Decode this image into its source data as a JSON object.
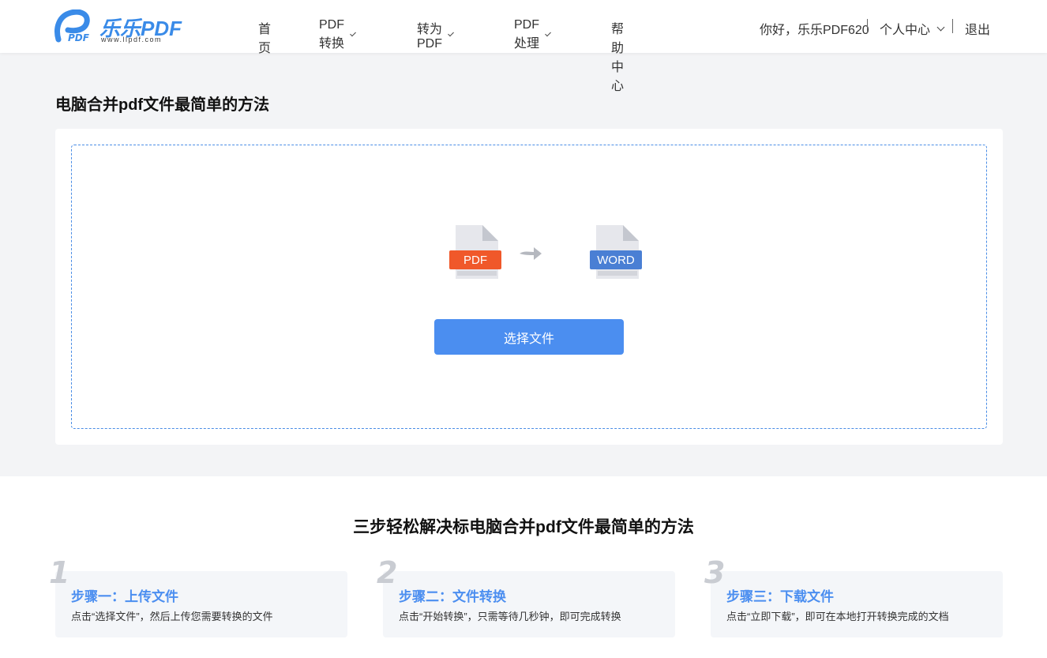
{
  "header": {
    "logo_text": "乐乐PDF",
    "logo_sub": "www.llpdf.com",
    "logo_mark_text": "PDF",
    "nav": [
      {
        "label": "首页",
        "has_dropdown": false
      },
      {
        "label": "PDF转换",
        "has_dropdown": true
      },
      {
        "label": "转为PDF",
        "has_dropdown": true
      },
      {
        "label": "PDF处理",
        "has_dropdown": true
      },
      {
        "label": "帮助中心",
        "has_dropdown": false
      }
    ],
    "greeting": "你好，乐乐PDF620",
    "user_center": "个人中心",
    "logout": "退出"
  },
  "main": {
    "title": "电脑合并pdf文件最简单的方法",
    "source_format": "PDF",
    "target_format": "WORD",
    "select_button": "选择文件"
  },
  "steps": {
    "title": "三步轻松解决标电脑合并pdf文件最简单的方法",
    "items": [
      {
        "num": "1",
        "title": "步骤一：上传文件",
        "desc": "点击“选择文件”，然后上传您需要转换的文件"
      },
      {
        "num": "2",
        "title": "步骤二：文件转换",
        "desc": "点击“开始转换”，只需等待几秒钟，即可完成转换"
      },
      {
        "num": "3",
        "title": "步骤三：下载文件",
        "desc": "点击“立即下载”，即可在本地打开转换完成的文档"
      }
    ]
  },
  "colors": {
    "accent": "#4b8ef0",
    "pdf_badge": "#f0582a",
    "word_badge": "#4a7fd4",
    "page_bg": "#f3f4f6"
  }
}
